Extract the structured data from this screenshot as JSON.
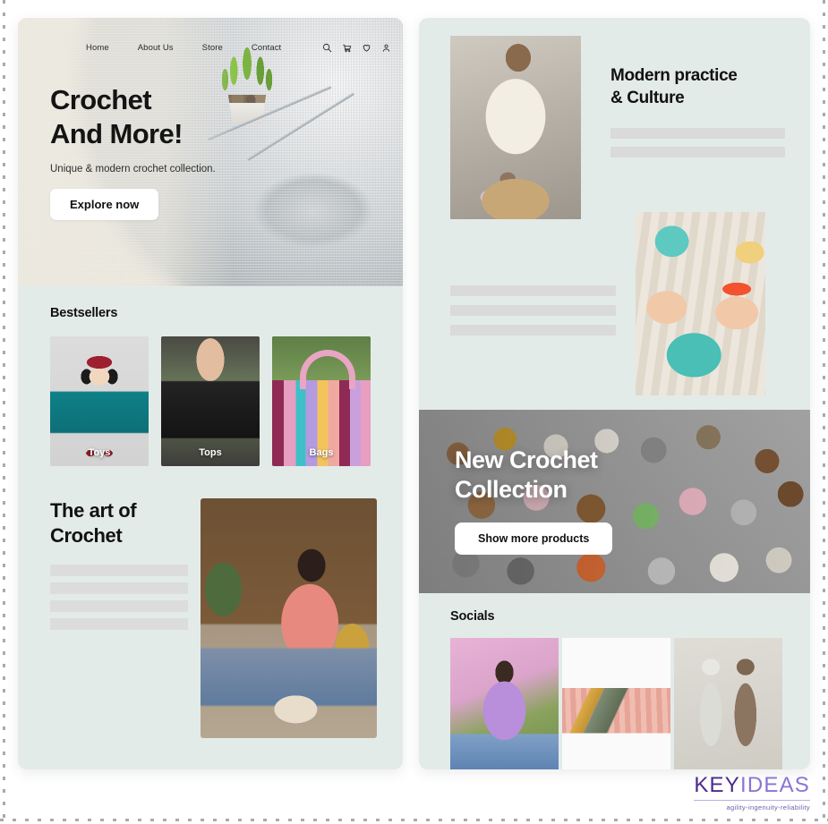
{
  "left_panel": {
    "nav": {
      "links": [
        {
          "label": "Home"
        },
        {
          "label": "About Us"
        },
        {
          "label": "Store"
        },
        {
          "label": "Contact"
        }
      ],
      "icons": [
        {
          "name": "search-icon"
        },
        {
          "name": "cart-icon"
        },
        {
          "name": "heart-icon"
        },
        {
          "name": "user-icon"
        }
      ]
    },
    "hero": {
      "title_line1": "Crochet",
      "title_line2": "And More!",
      "subtitle": "Unique & modern crochet collection.",
      "cta_label": "Explore now"
    },
    "bestsellers": {
      "title": "Bestsellers",
      "items": [
        {
          "label": "Toys"
        },
        {
          "label": "Tops"
        },
        {
          "label": "Bags"
        }
      ]
    },
    "art": {
      "title_line1": "The art of",
      "title_line2": "Crochet",
      "placeholder_bars": 4
    }
  },
  "right_panel": {
    "modern": {
      "title_line1": "Modern practice",
      "title_line2": "& Culture",
      "placeholder_bars": 2
    },
    "mid": {
      "placeholder_bars": 3
    },
    "collection": {
      "title_line1": "New Crochet",
      "title_line2": "Collection",
      "cta_label": "Show more products"
    },
    "socials": {
      "title": "Socials",
      "items": [
        {
          "name": "social-image-sweater"
        },
        {
          "name": "social-image-hook"
        },
        {
          "name": "social-image-ferrets"
        }
      ]
    }
  },
  "footer": {
    "logo_part1": "KEY",
    "logo_part2": "IDEAS",
    "tagline": "agility-ingenuity-reliability"
  },
  "colors": {
    "panel_bg": "#e3ebe9",
    "page_bg": "#ffffff",
    "placeholder": "#dcdcdc",
    "logo_dark": "#4b2a8f",
    "logo_light": "#8b73d4"
  }
}
